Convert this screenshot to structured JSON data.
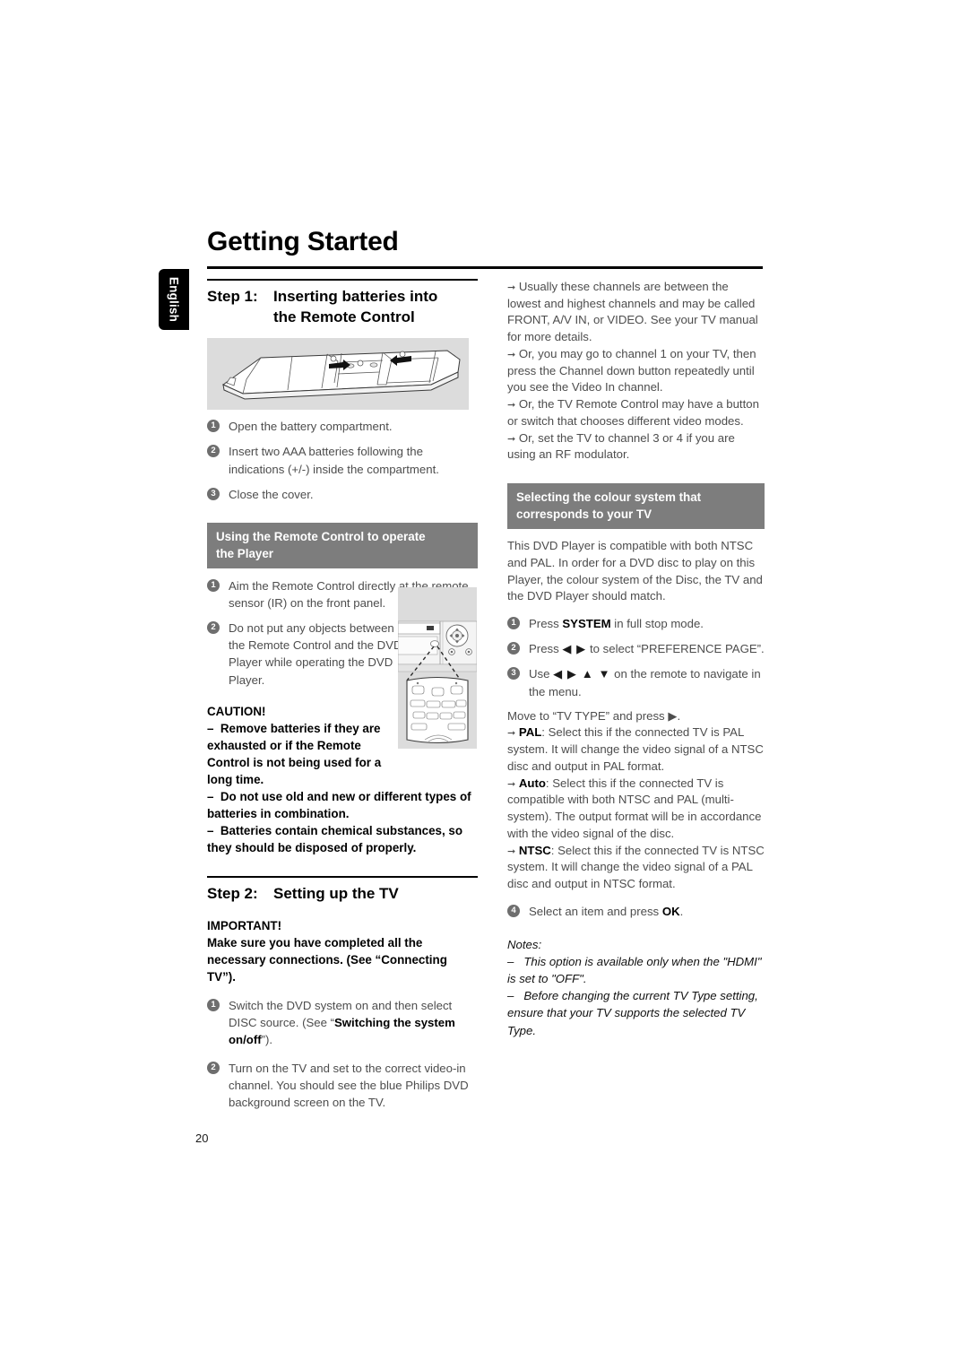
{
  "meta": {
    "page_number": "20",
    "language_tab": "English",
    "title": "Getting Started",
    "colors": {
      "section_header_bg": "#7d7d7d",
      "bullet_bg": "#6e6e6e",
      "figure_bg": "#dcdcdc",
      "body_text": "#4d4d4d",
      "heading_text": "#000000",
      "tab_bg": "#000000"
    }
  },
  "left_column": {
    "step1": {
      "label": "Step 1:",
      "title": "Inserting batteries into the Remote Control",
      "title_line1": "Inserting batteries into",
      "title_line2": "the Remote Control",
      "figure_caption": "remote-control-battery-compartment-illustration",
      "items": [
        {
          "num": "1",
          "text": "Open the battery compartment."
        },
        {
          "num": "2",
          "text": "Insert two AAA batteries following the indications (+/-) inside the compartment."
        },
        {
          "num": "3",
          "text": "Close the cover."
        }
      ]
    },
    "remote_section": {
      "header": "Using the Remote Control to operate the Player",
      "header_line1": "Using the Remote Control to operate",
      "header_line2": "the Player",
      "items": [
        {
          "num": "1",
          "text": "Aim the Remote Control directly at the remote sensor (IR) on the front panel."
        },
        {
          "num": "2",
          "text": "Do not put any objects between the Remote Control and the DVD Player while operating the DVD Player."
        }
      ],
      "figure_caption": "dvd-player-and-remote-aiming-illustration"
    },
    "caution": {
      "title": "CAUTION!",
      "bullets": [
        "Remove batteries if they are exhausted or if the Remote Control is not being used for a long time.",
        "Do not use old and new or different types of batteries in combination.",
        "Batteries contain chemical substances, so they should be disposed of properly."
      ]
    },
    "step2": {
      "label": "Step 2:",
      "title": "Setting up the TV",
      "important_title": "IMPORTANT!",
      "important_text": "Make sure you have completed all the necessary connections. (See “Connecting TV”).",
      "items": [
        {
          "num": "1",
          "text_before": "Switch the DVD system on and then select DISC source. (See “",
          "bold": "Switching the system on/off",
          "text_after": "”)."
        },
        {
          "num": "2",
          "text": "Turn on the TV and set to the correct video-in channel. You should see the blue Philips DVD background screen on the TV."
        }
      ]
    }
  },
  "right_column": {
    "arrow_notes_top": [
      "Usually these channels are between the lowest and highest channels and may be called FRONT, A/V IN, or VIDEO. See your TV manual for more details.",
      "Or, you may go to channel 1 on your TV, then press the Channel down button repeatedly until you see the Video In channel.",
      "Or, the TV Remote Control may have a button or switch that chooses different video modes.",
      "Or, set the TV to channel 3 or 4 if you are using an RF modulator."
    ],
    "colour_section": {
      "header": "Selecting the colour system that corresponds to your TV",
      "header_line1": "Selecting the colour system that",
      "header_line2": "corresponds to your TV",
      "intro": "This DVD Player is compatible with both NTSC and PAL. In order for a DVD disc to play on this Player, the colour system of the Disc, the TV and the DVD Player should match.",
      "items": [
        {
          "num": "1",
          "text_before": "Press ",
          "bold": "SYSTEM",
          "text_after": " in full stop mode."
        },
        {
          "num": "2",
          "text_before": "Press ",
          "keys": "◀ ▶",
          "text_after": " to select “PREFERENCE PAGE”."
        },
        {
          "num": "3",
          "text_before": "Use ",
          "keys": "◀ ▶ ▲ ▼",
          "text_after": " on the remote to navigate in the menu."
        }
      ],
      "move_line": "Move to “TV TYPE” and press ▶.",
      "options": [
        {
          "name": "PAL",
          "desc": ": Select this if the connected TV is PAL system. It will change the video signal of a NTSC disc and output in PAL format."
        },
        {
          "name": "Auto",
          "desc": ": Select this if the connected TV is compatible with both NTSC and PAL (multi-system). The output format will be in accordance with the video signal of the disc."
        },
        {
          "name": "NTSC",
          "desc": ": Select this if the connected TV is NTSC system. It will change the video signal of a PAL disc and output in NTSC format."
        }
      ],
      "final_item": {
        "num": "4",
        "text_before": "Select an item and press ",
        "bold": "OK",
        "text_after": "."
      }
    },
    "notes": {
      "title": "Notes:",
      "items": [
        "This option is available only when the \"HDMI\" is set to \"OFF\".",
        "Before changing the current TV Type setting, ensure that your TV supports the selected TV Type."
      ]
    }
  }
}
